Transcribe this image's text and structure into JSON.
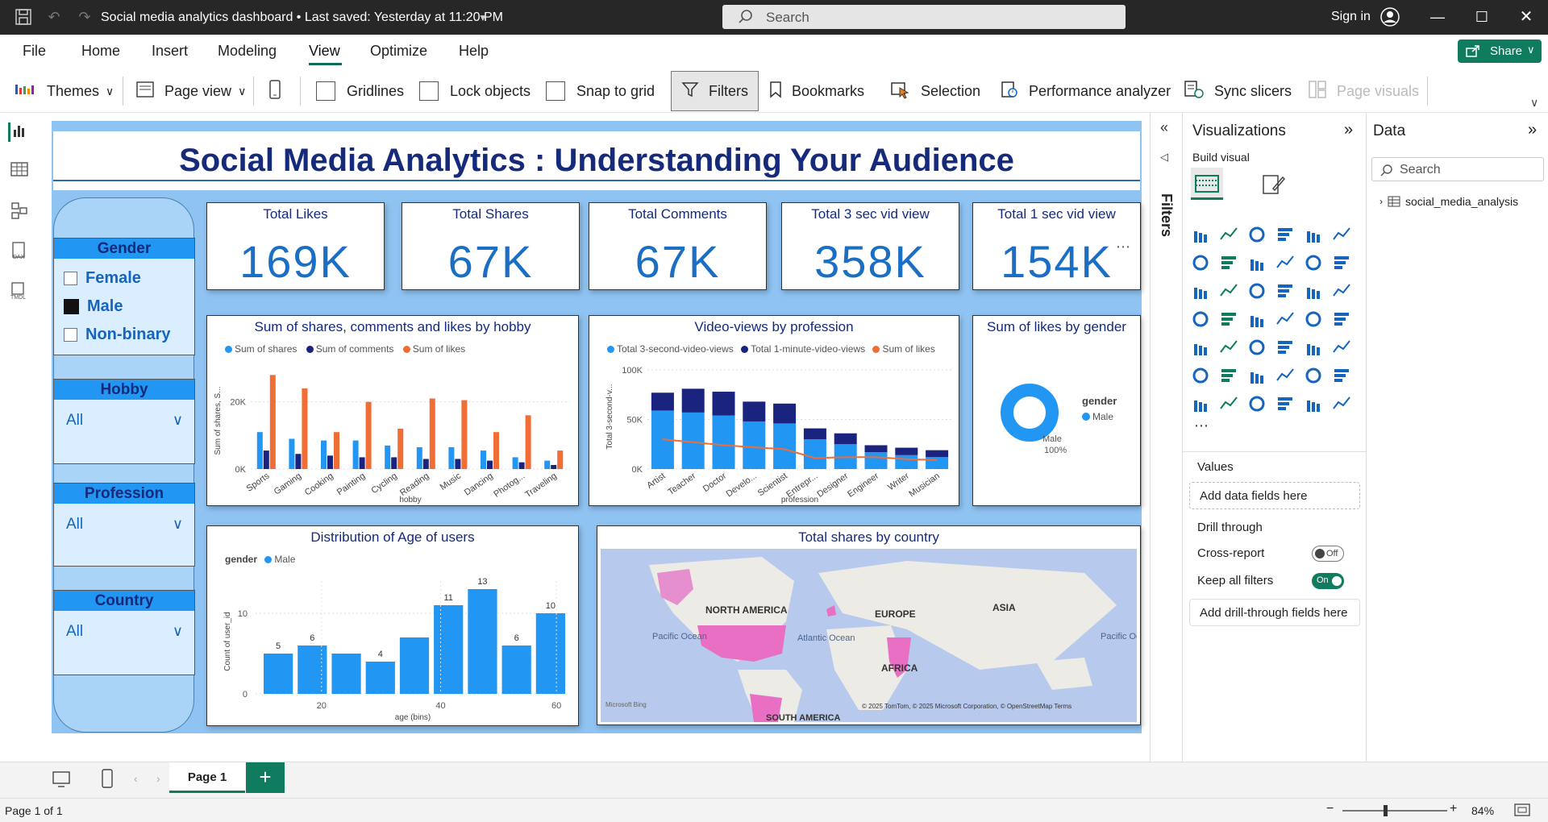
{
  "titlebar": {
    "doc_title": "Social media analytics dashboard • Last saved: Yesterday at 11:20 PM",
    "search_placeholder": "Search",
    "signin": "Sign in"
  },
  "menu": [
    "File",
    "Home",
    "Insert",
    "Modeling",
    "View",
    "Optimize",
    "Help"
  ],
  "share_label": "Share",
  "toolbar": {
    "themes": "Themes",
    "page_view": "Page view",
    "gridlines": "Gridlines",
    "lock_objects": "Lock objects",
    "snap_to_grid": "Snap to grid",
    "filters": "Filters",
    "bookmarks": "Bookmarks",
    "selection": "Selection",
    "performance_analyzer": "Performance analyzer",
    "sync_slicers": "Sync slicers",
    "page_visuals": "Page visuals"
  },
  "report": {
    "title": "Social Media Analytics : Understanding Your Audience"
  },
  "slicers": {
    "gender": {
      "title": "Gender",
      "options": [
        {
          "label": "Female",
          "checked": false
        },
        {
          "label": "Male",
          "checked": true
        },
        {
          "label": "Non-binary",
          "checked": false
        }
      ]
    },
    "hobby": {
      "title": "Hobby",
      "value": "All"
    },
    "profession": {
      "title": "Profession",
      "value": "All"
    },
    "country": {
      "title": "Country",
      "value": "All"
    }
  },
  "kpis": [
    {
      "title": "Total Likes",
      "value": "169K"
    },
    {
      "title": "Total Shares",
      "value": "67K"
    },
    {
      "title": "Total Comments",
      "value": "67K"
    },
    {
      "title": "Total 3 sec vid view",
      "value": "358K"
    },
    {
      "title": "Total 1 sec vid view",
      "value": "154K"
    }
  ],
  "colors": {
    "series_light": "#2196f3",
    "series_dark": "#1a237e",
    "series_orange": "#f06d35",
    "accent": "#0f7b5f"
  },
  "chart_data": [
    {
      "type": "bar",
      "title": "Sum of shares, comments and likes by hobby",
      "xlabel": "hobby",
      "ylabel": "Sum of shares, S...",
      "yticks": [
        "0K",
        "20K"
      ],
      "ylim": [
        0,
        30000
      ],
      "categories": [
        "Sports",
        "Gaming",
        "Cooking",
        "Painting",
        "Cycling",
        "Reading",
        "Music",
        "Dancing",
        "Photog...",
        "Traveling"
      ],
      "series": [
        {
          "name": "Sum of shares",
          "values": [
            11000,
            9000,
            8500,
            8500,
            7000,
            6500,
            6500,
            5500,
            3500,
            2500
          ]
        },
        {
          "name": "Sum of comments",
          "values": [
            5500,
            4500,
            4000,
            3500,
            3500,
            3000,
            3000,
            2500,
            2000,
            1200
          ]
        },
        {
          "name": "Sum of likes",
          "values": [
            28000,
            24000,
            11000,
            20000,
            12000,
            21000,
            20500,
            11000,
            16000,
            5500
          ]
        }
      ]
    },
    {
      "type": "bar",
      "title": "Video-views by profession",
      "xlabel": "profession",
      "ylabel": "Total 3-second-v...",
      "yticks": [
        "0K",
        "50K",
        "100K"
      ],
      "ylim": [
        0,
        100000
      ],
      "categories": [
        "Artist",
        "Teacher",
        "Doctor",
        "Develo...",
        "Scientist",
        "Entrepr...",
        "Designer",
        "Engineer",
        "Writer",
        "Musician"
      ],
      "series": [
        {
          "name": "Total 3-second-video-views",
          "values": [
            59000,
            57000,
            54000,
            48000,
            46000,
            30000,
            25000,
            17000,
            14000,
            12000
          ]
        },
        {
          "name": "Total 1-minute-video-views",
          "values": [
            18000,
            24000,
            24000,
            20000,
            20000,
            11000,
            11000,
            7000,
            7500,
            7000
          ]
        },
        {
          "name": "Sum of likes",
          "values": [
            30000,
            27000,
            24000,
            22000,
            20000,
            11000,
            12000,
            12000,
            10000,
            9000
          ]
        }
      ]
    },
    {
      "type": "pie",
      "title": "Sum of likes by gender",
      "legend_title": "gender",
      "slices": [
        {
          "name": "Male",
          "value": 100,
          "label": "Male",
          "pct": "100%"
        }
      ]
    },
    {
      "type": "bar",
      "title": "Distribution of Age of users",
      "legend_title": "gender",
      "legend": [
        "Male"
      ],
      "xlabel": "age (bins)",
      "ylabel": "Count of user_id",
      "xticks": [
        "20",
        "40",
        "60"
      ],
      "yticks": [
        "0",
        "10"
      ],
      "ylim": [
        0,
        14
      ],
      "values": [
        5,
        6,
        5,
        4,
        7,
        11,
        13,
        6,
        10
      ],
      "labels": [
        "5",
        "6",
        "",
        "4",
        "",
        "11",
        "13",
        "6",
        "10"
      ]
    }
  ],
  "map": {
    "title": "Total shares by country",
    "labels": [
      "NORTH AMERICA",
      "EUROPE",
      "ASIA",
      "AFRICA",
      "SOUTH AMERICA",
      "Pacific Ocean",
      "Atlantic Ocean",
      "Pacific Ocean"
    ],
    "credit": "© 2025 TomTom, © 2025 Microsoft Corporation, © OpenStreetMap  Terms",
    "brand": "Microsoft Bing"
  },
  "filters_rail_label": "Filters",
  "visualizations": {
    "title": "Visualizations",
    "build_visual": "Build visual",
    "values_label": "Values",
    "values_placeholder": "Add data fields here",
    "drill_through": "Drill through",
    "cross_report": "Cross-report",
    "cross_report_state": "Off",
    "keep_all_filters": "Keep all filters",
    "keep_all_filters_state": "On",
    "drill_placeholder": "Add drill-through fields here"
  },
  "data_pane": {
    "title": "Data",
    "search_placeholder": "Search",
    "tables": [
      "social_media_analysis"
    ]
  },
  "pages": {
    "tab": "Page 1"
  },
  "status": {
    "page": "Page 1 of 1",
    "zoom": "84%"
  }
}
